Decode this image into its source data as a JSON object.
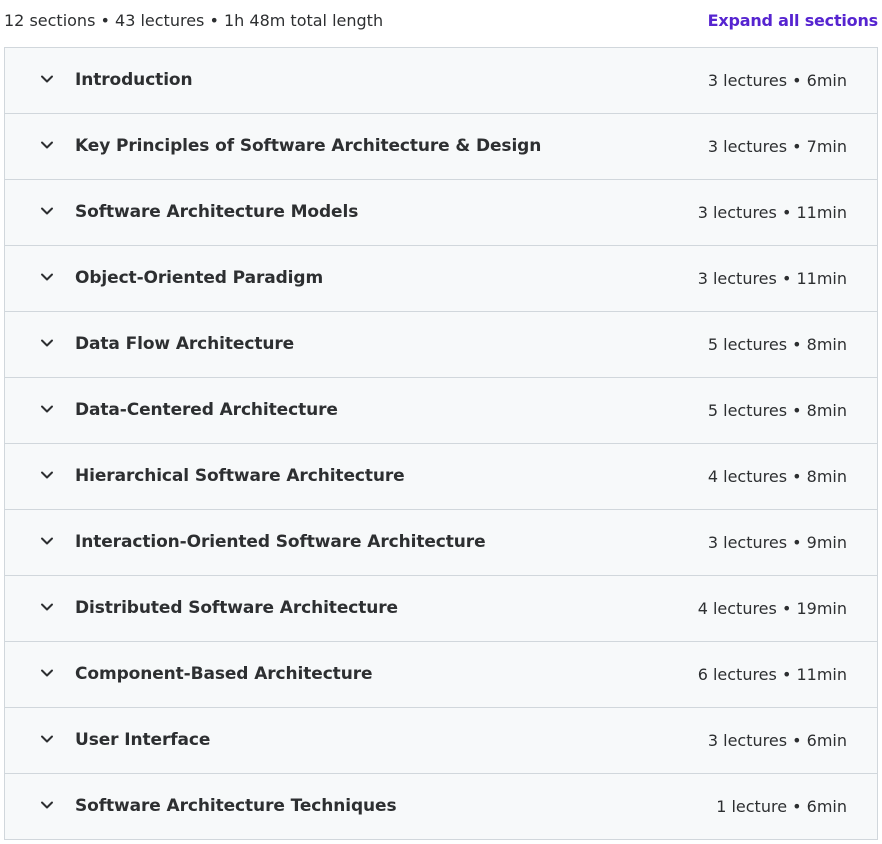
{
  "summary": {
    "text": "12 sections • 43 lectures • 1h 48m total length",
    "expand_label": "Expand all sections"
  },
  "colors": {
    "accent": "#5624d0",
    "row_background": "#f7f9fa",
    "border": "#d1d7dc",
    "text": "#2d2f31"
  },
  "sections": [
    {
      "title": "Introduction",
      "meta": "3 lectures • 6min",
      "icon": "chevron-down-icon"
    },
    {
      "title": "Key Principles of Software Architecture & Design",
      "meta": "3 lectures • 7min",
      "icon": "chevron-down-icon"
    },
    {
      "title": "Software Architecture Models",
      "meta": "3 lectures • 11min",
      "icon": "chevron-down-icon"
    },
    {
      "title": "Object-Oriented Paradigm",
      "meta": "3 lectures • 11min",
      "icon": "chevron-down-icon"
    },
    {
      "title": "Data Flow Architecture",
      "meta": "5 lectures • 8min",
      "icon": "chevron-down-icon"
    },
    {
      "title": "Data-Centered Architecture",
      "meta": "5 lectures • 8min",
      "icon": "chevron-down-icon"
    },
    {
      "title": "Hierarchical Software Architecture",
      "meta": "4 lectures • 8min",
      "icon": "chevron-down-icon"
    },
    {
      "title": "Interaction-Oriented Software Architecture",
      "meta": "3 lectures • 9min",
      "icon": "chevron-down-icon"
    },
    {
      "title": "Distributed Software Architecture",
      "meta": "4 lectures • 19min",
      "icon": "chevron-down-icon"
    },
    {
      "title": "Component-Based Architecture",
      "meta": "6 lectures • 11min",
      "icon": "chevron-down-icon"
    },
    {
      "title": "User Interface",
      "meta": "3 lectures • 6min",
      "icon": "chevron-down-icon"
    },
    {
      "title": "Software Architecture Techniques",
      "meta": "1 lecture • 6min",
      "icon": "chevron-down-icon"
    }
  ]
}
